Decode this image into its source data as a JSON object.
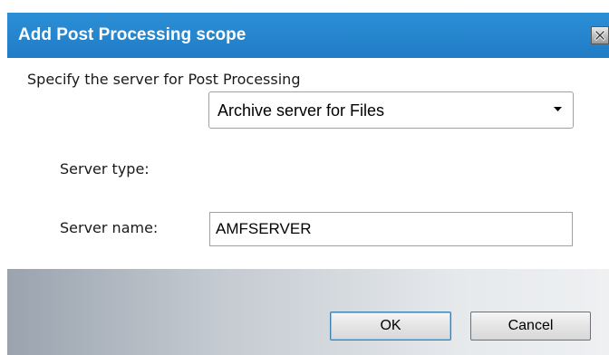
{
  "dialog": {
    "title": "Add Post Processing scope",
    "prompt": "Specify the server for Post Processing",
    "server_type": {
      "label": "Server type:",
      "selected": "Archive server for Files"
    },
    "server_name": {
      "label": "Server name:",
      "value": "AMFSERVER"
    },
    "buttons": {
      "ok": "OK",
      "cancel": "Cancel"
    }
  },
  "colors": {
    "title_bar": "#1f7cc5",
    "title_text": "#ffffff"
  },
  "icons": {
    "close": "close-icon",
    "dropdown": "chevron-down-icon"
  }
}
